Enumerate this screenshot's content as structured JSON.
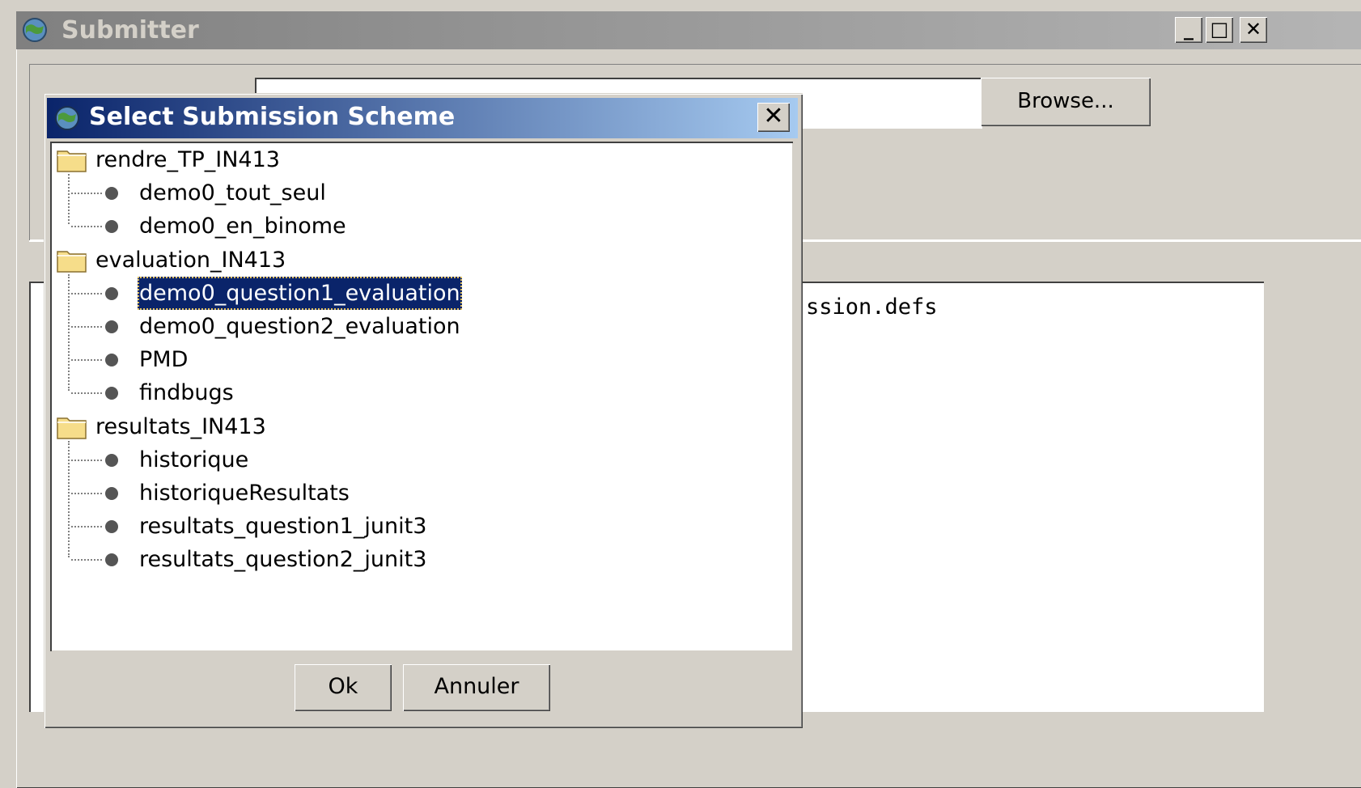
{
  "main_window": {
    "title": "Submitter",
    "browse_label": "Browse...",
    "minimize_glyph": "_",
    "maximize_glyph": "□",
    "close_glyph": "✕",
    "output_text": "ssion.defs"
  },
  "dialog": {
    "title": "Select Submission Scheme",
    "close_glyph": "✕",
    "ok_label": "Ok",
    "cancel_label": "Annuler"
  },
  "tree": {
    "groups": [
      {
        "label": "rendre_TP_IN413",
        "items": [
          "demo0_tout_seul",
          "demo0_en_binome"
        ]
      },
      {
        "label": "evaluation_IN413",
        "items": [
          "demo0_question1_evaluation",
          "demo0_question2_evaluation",
          "PMD",
          "findbugs"
        ]
      },
      {
        "label": "resultats_IN413",
        "items": [
          "historique",
          "historiqueResultats",
          "resultats_question1_junit3",
          "resultats_question2_junit3"
        ]
      }
    ],
    "selected_item": "demo0_question1_evaluation"
  },
  "colors": {
    "active_title_start": "#0a246a",
    "active_title_end": "#a6caf0",
    "selection": "#0a246a",
    "face": "#d4d0c8"
  }
}
